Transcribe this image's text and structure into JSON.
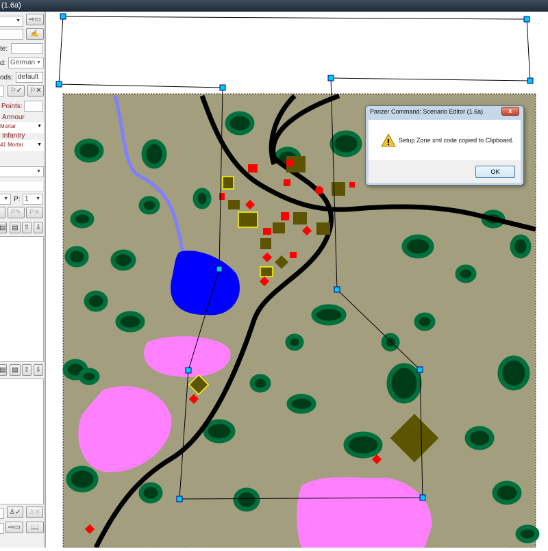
{
  "window": {
    "title": "(1.6a)"
  },
  "left_panel": {
    "date_label": "te:",
    "date_value": "",
    "side_label": "d:",
    "side_value": "German",
    "mods_label": "ods:",
    "mods_value": "default",
    "points_label": "Points:",
    "points_value": "",
    "armour_label": "Armour",
    "armour_value": "Mortar",
    "infantry_label": "Infantry",
    "infantry_value": "41 Mortar",
    "p_label": "P:",
    "p_value": "1",
    "p_edit": "P✎",
    "p_delete": "P✕"
  },
  "dialog": {
    "title": "Panzer Command: Scenario Editor (1.6a)",
    "close": "x",
    "message": "Setup Zone xml code copied to Clipboard.",
    "ok_label": "OK",
    "icon": "warning-icon"
  },
  "colors": {
    "terrain": "#a29e7e",
    "forest": "#006f3c",
    "forest_dark": "#003b17",
    "road": "#000000",
    "river": "#8080ff",
    "lake": "#0000ff",
    "pink": "#ff80ff",
    "unit_olive": "#5c5400",
    "unit_red": "#ff0000"
  }
}
